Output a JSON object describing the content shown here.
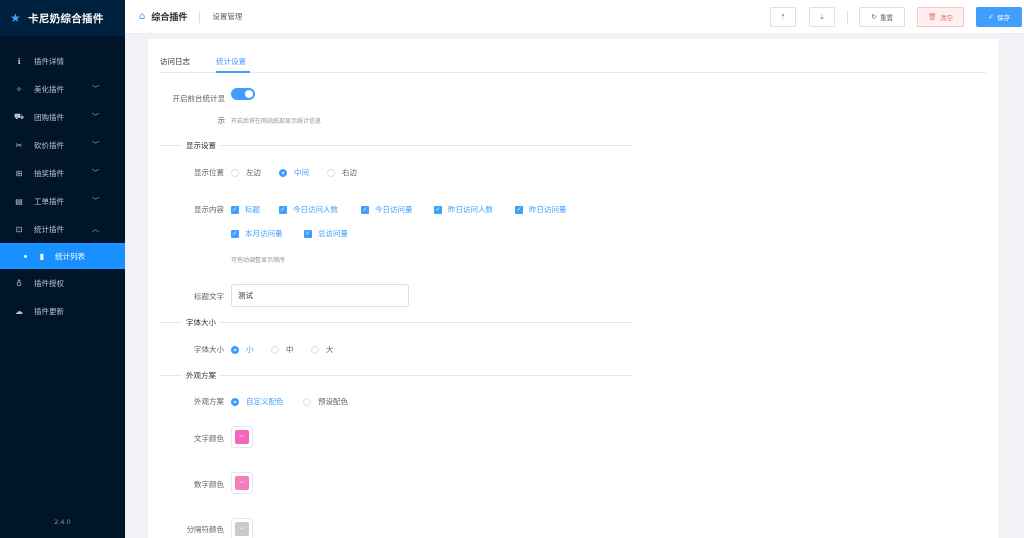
{
  "app": {
    "name": "卡尼奶综合插件",
    "version": "2.4.0"
  },
  "sidebar": {
    "items": [
      {
        "label": "插件详情",
        "icon": "info-icon",
        "glyph": "ℹ"
      },
      {
        "label": "美化插件",
        "icon": "magic-icon",
        "glyph": "✧",
        "expandable": true
      },
      {
        "label": "团购插件",
        "icon": "cart-icon",
        "glyph": "⛟",
        "expandable": true
      },
      {
        "label": "砍价插件",
        "icon": "scissors-icon",
        "glyph": "✂",
        "expandable": true
      },
      {
        "label": "抽奖插件",
        "icon": "gift-icon",
        "glyph": "⊞",
        "expandable": true
      },
      {
        "label": "工单插件",
        "icon": "document-icon",
        "glyph": "▤",
        "expandable": true
      },
      {
        "label": "统计插件",
        "icon": "stats-icon",
        "glyph": "⊡",
        "expanded": true
      },
      {
        "label": "统计列表",
        "icon": "bar-chart-icon",
        "glyph": "▮",
        "active": true
      },
      {
        "label": "插件授权",
        "icon": "license-icon",
        "glyph": "♁"
      },
      {
        "label": "插件更新",
        "icon": "cloud-icon",
        "glyph": "☁"
      }
    ]
  },
  "header": {
    "title": "综合插件",
    "subtitle": "设置管理",
    "buttons": {
      "upload": "⇡",
      "download": "⇣",
      "reset": "重置",
      "clear": "清空",
      "save": "保存"
    }
  },
  "tabs": [
    "访问日志",
    "统计设置"
  ],
  "form": {
    "enable_label": "开启前台统计显示",
    "enable_label_line1": "开启前台统计显",
    "enable_label_line2": "示",
    "enable_hint": "开启后将在网站底部显示统计信息",
    "display_section": "显示设置",
    "position_label": "显示位置",
    "position_options": [
      "左边",
      "中间",
      "右边"
    ],
    "position_selected": "中间",
    "content_label": "显示内容",
    "content_options": [
      "标题",
      "今日访问人数",
      "今日访问量",
      "昨日访问人数",
      "昨日访问量",
      "本月访问量",
      "总访问量"
    ],
    "content_hint": "可拖动调整显示顺序",
    "title_text_label": "标题文字",
    "title_text_value": "测试",
    "font_section": "字体大小",
    "font_label": "字体大小",
    "font_options": [
      "小",
      "中",
      "大"
    ],
    "font_selected": "小",
    "theme_section": "外观方案",
    "theme_label": "外观方案",
    "theme_options": [
      "自定义配色",
      "预设配色"
    ],
    "theme_selected": "自定义配色",
    "text_color_label": "文字颜色",
    "text_color": "#f565b8",
    "number_color_label": "数字颜色",
    "number_color": "#f27ebb",
    "separator_color_label": "分隔符颜色",
    "separator_color": "#c7c9cc"
  },
  "colors": {
    "accent": "#409eff",
    "sidebar_bg": "#001529",
    "clear_button": "#f56c6c"
  }
}
